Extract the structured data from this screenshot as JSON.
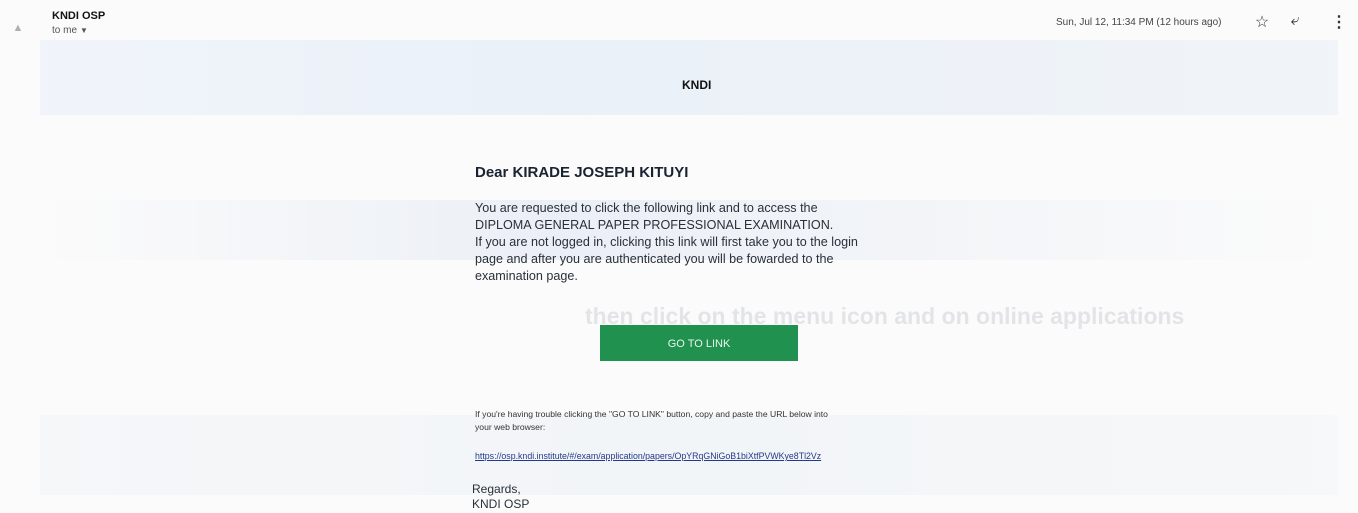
{
  "header": {
    "sender": "KNDI OSP",
    "recipient": "to me",
    "datetime": "Sun, Jul 12, 11:34 PM (12 hours ago)"
  },
  "email": {
    "brand": "KNDI",
    "greeting": "Dear KIRADE JOSEPH KITUYI",
    "body_lines": [
      "You are requested to click the following link and to access the",
      "DIPLOMA GENERAL PAPER PROFESSIONAL EXAMINATION.",
      "If you are not logged in, clicking this link will first take you to the login",
      "page and after you are authenticated you will be fowarded to the",
      "examination page."
    ],
    "button_label": "GO TO LINK",
    "trouble_lines": [
      "If you're having trouble clicking the \"GO TO LINK\" button, copy and paste the URL below into",
      "your web browser:"
    ],
    "url": "https://osp.kndi.institute/#/exam/application/papers/OpYRqGNiGoB1biXtfPVWKye8Tl2Vz",
    "signoff": "Regards,",
    "signature": "KNDI OSP"
  },
  "background": {
    "bleed_text": "then click on the menu icon and on online applications"
  },
  "icons": {
    "avatar": "person-icon",
    "star": "star-icon",
    "reply": "reply-icon",
    "more": "more-vert-icon"
  },
  "colors": {
    "button": "#219150",
    "link": "#233a8a"
  }
}
